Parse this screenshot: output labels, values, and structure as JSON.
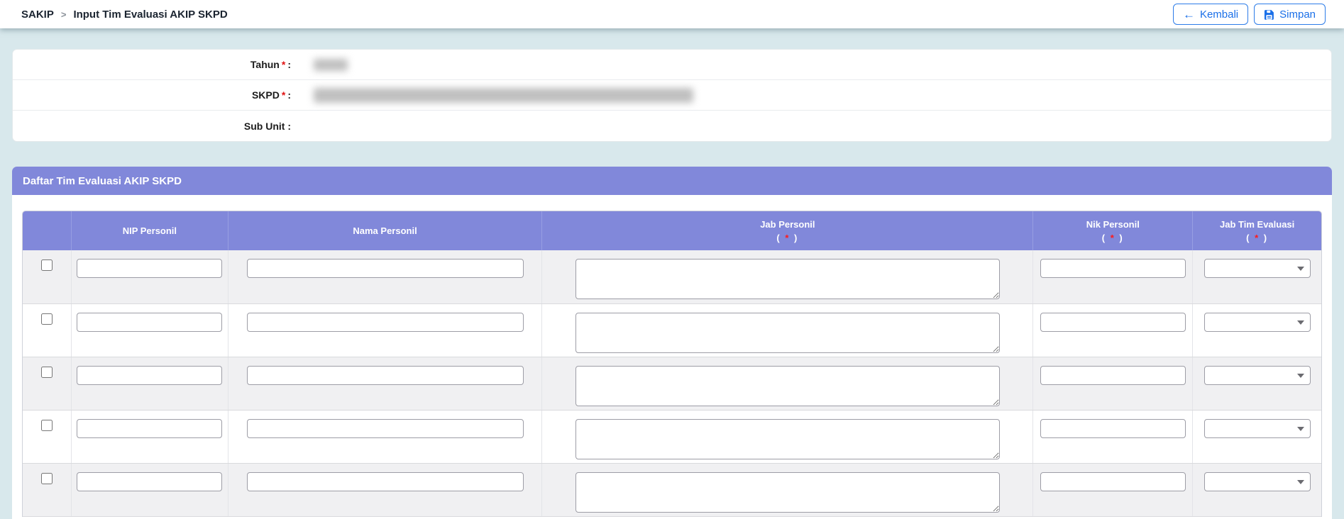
{
  "breadcrumb": {
    "root": "SAKIP",
    "separator": ">",
    "current": "Input Tim Evaluasi AKIP SKPD"
  },
  "toolbar": {
    "back_label": "Kembali",
    "save_label": "Simpan"
  },
  "form": {
    "colon": ":",
    "required_star": "*",
    "fields": [
      {
        "label": "Tahun",
        "required": true,
        "value_redacted": true
      },
      {
        "label": "SKPD",
        "required": true,
        "value_redacted": true
      },
      {
        "label": "Sub Unit",
        "required": false,
        "value_redacted": false
      }
    ]
  },
  "panel": {
    "title": "Daftar Tim Evaluasi AKIP SKPD"
  },
  "table": {
    "required_open": "(",
    "required_star": "*",
    "required_close": ")",
    "columns": [
      {
        "label": "",
        "required": false
      },
      {
        "label": "NIP Personil",
        "required": false
      },
      {
        "label": "Nama Personil",
        "required": false
      },
      {
        "label": "Jab Personil",
        "required": true
      },
      {
        "label": "Nik Personil",
        "required": true
      },
      {
        "label": "Jab Tim Evaluasi",
        "required": true
      }
    ],
    "rows": [
      {
        "selected": false,
        "nip": "",
        "nama": "",
        "jab": "",
        "nik": "",
        "jab_tim": ""
      },
      {
        "selected": false,
        "nip": "",
        "nama": "",
        "jab": "",
        "nik": "",
        "jab_tim": ""
      },
      {
        "selected": false,
        "nip": "",
        "nama": "",
        "jab": "",
        "nik": "",
        "jab_tim": ""
      },
      {
        "selected": false,
        "nip": "",
        "nama": "",
        "jab": "",
        "nik": "",
        "jab_tim": ""
      },
      {
        "selected": false,
        "nip": "",
        "nama": "",
        "jab": "",
        "nik": "",
        "jab_tim": ""
      }
    ]
  },
  "colors": {
    "accent_purple": "#8188da",
    "page_background": "#d8e8ec",
    "button_blue": "#1a6fe8",
    "required_red": "#e01313",
    "row_alt_gray": "#f0f0f2"
  }
}
